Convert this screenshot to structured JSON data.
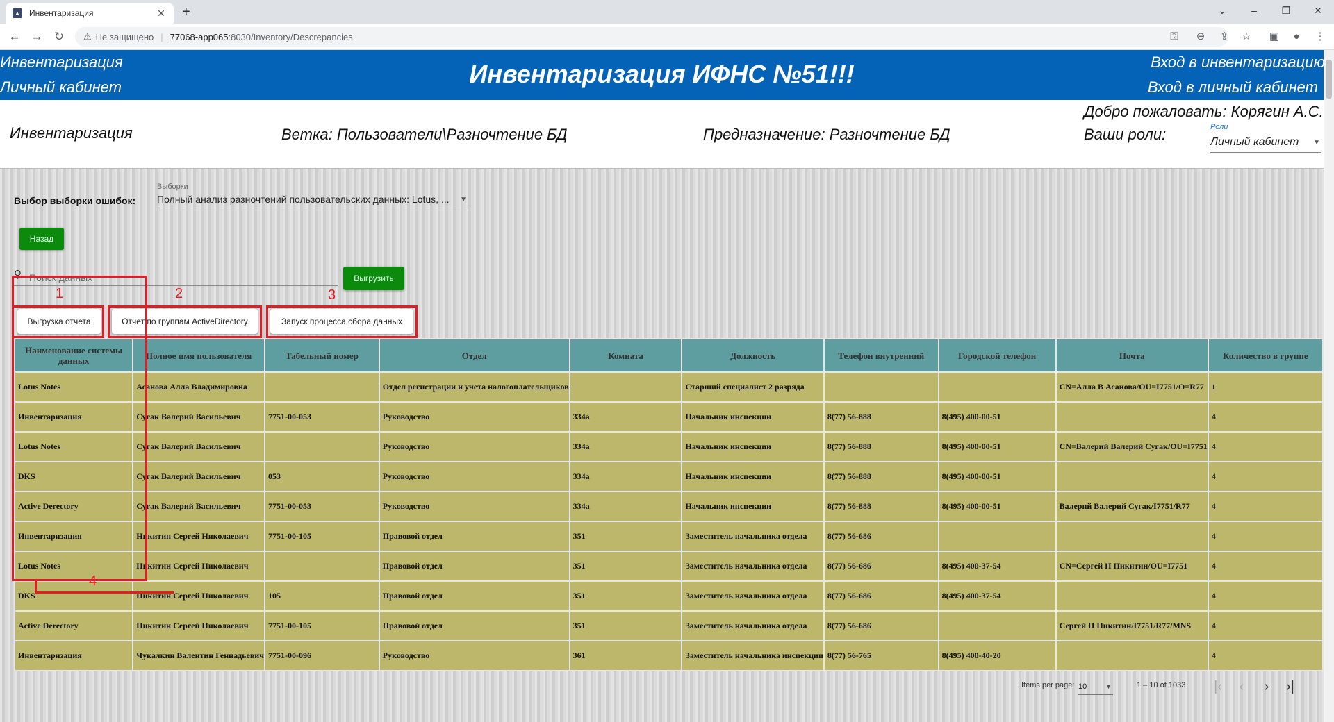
{
  "browser": {
    "tab_title": "Инвентаризация",
    "tab_close": "✕",
    "new_tab": "+",
    "security_label": "Не защищено",
    "url_host": "77068-app065",
    "url_path": ":8030/Inventory/Descrepancies"
  },
  "header": {
    "left_link_1": "Инвентаризация",
    "left_link_2": "Личный кабинет",
    "title": "Инвентаризация ИФНС №51!!!",
    "right_link_1": "Вход в инвентаризацию",
    "right_link_2": "Вход в личный кабинет"
  },
  "subheader": {
    "section": "Инвентаризация",
    "branch": "Ветка: Пользователи\\Разночтение БД",
    "purpose": "Предназначение: Разночтение БД",
    "welcome": "Добро пожаловать: Корягин А.С.",
    "roles_label": "Ваши роли:",
    "roles_field_label": "Роли",
    "roles_value": "Личный кабинет"
  },
  "selection": {
    "label": "Выбор выборки ошибок:",
    "field_label": "Выборки",
    "value": "Полный анализ разночтений пользовательских данных: Lotus, ..."
  },
  "buttons": {
    "back": "Назад",
    "export": "Выгрузить",
    "report_export": "Выгрузка отчета",
    "ad_groups_report": "Отчет по группам ActiveDirectory",
    "start_collection": "Запуск процесса сбора данных"
  },
  "search": {
    "placeholder": "Поиск данных"
  },
  "annotations": [
    "1",
    "2",
    "3",
    "4"
  ],
  "table": {
    "columns": [
      "Наименование системы данных",
      "Полное имя пользователя",
      "Табельный номер",
      "Отдел",
      "Комната",
      "Должность",
      "Телефон внутренний",
      "Городской телефон",
      "Почта",
      "Количество в группе"
    ],
    "rows": [
      [
        "Lotus Notes",
        "Асанова Алла Владимировна",
        "",
        "Отдел регистрации и учета налогоплательщиков",
        "",
        "Старший специалист 2 разряда",
        "",
        "",
        "CN=Алла В Асанова/OU=I7751/O=R77",
        "1"
      ],
      [
        "Инвентаризация",
        "Сугак Валерий Васильевич",
        "7751-00-053",
        "Руководство",
        "334а",
        "Начальник инспекции",
        "8(77) 56-888",
        "8(495) 400-00-51",
        "",
        "4"
      ],
      [
        "Lotus Notes",
        "Сугак Валерий Васильевич",
        "",
        "Руководство",
        "334а",
        "Начальник инспекции",
        "8(77) 56-888",
        "8(495) 400-00-51",
        "CN=Валерий Валерий Сугак/OU=I7751",
        "4"
      ],
      [
        "DKS",
        "Сугак Валерий Васильевич",
        "053",
        "Руководство",
        "334а",
        "Начальник инспекции",
        "8(77) 56-888",
        "8(495) 400-00-51",
        "",
        "4"
      ],
      [
        "Active Derectory",
        "Сугак Валерий Васильевич",
        "7751-00-053",
        "Руководство",
        "334а",
        "Начальник инспекции",
        "8(77) 56-888",
        "8(495) 400-00-51",
        "Валерий Валерий Сугак/I7751/R77",
        "4"
      ],
      [
        "Инвентаризация",
        "Никитин Сергей Николаевич",
        "7751-00-105",
        "Правовой отдел",
        "351",
        "Заместитель начальника отдела",
        "8(77) 56-686",
        "",
        "",
        "4"
      ],
      [
        "Lotus Notes",
        "Никитин Сергей Николаевич",
        "",
        "Правовой отдел",
        "351",
        "Заместитель начальника отдела",
        "8(77) 56-686",
        "8(495) 400-37-54",
        "CN=Сергей Н Никитин/OU=I7751",
        "4"
      ],
      [
        "DKS",
        "Никитин Сергей Николаевич",
        "105",
        "Правовой отдел",
        "351",
        "Заместитель начальника отдела",
        "8(77) 56-686",
        "8(495) 400-37-54",
        "",
        "4"
      ],
      [
        "Active Derectory",
        "Никитин Сергей Николаевич",
        "7751-00-105",
        "Правовой отдел",
        "351",
        "Заместитель начальника отдела",
        "8(77) 56-686",
        "",
        "Сергей Н Никитин/I7751/R77/MNS",
        "4"
      ],
      [
        "Инвентаризация",
        "Чукалкин Валентин Геннадьевич",
        "7751-00-096",
        "Руководство",
        "361",
        "Заместитель начальника инспекции",
        "8(77) 56-765",
        "8(495) 400-40-20",
        "",
        "4"
      ]
    ]
  },
  "paginator": {
    "items_per_page_label": "Items per page:",
    "items_per_page": "10",
    "range": "1 – 10 of 1033"
  }
}
